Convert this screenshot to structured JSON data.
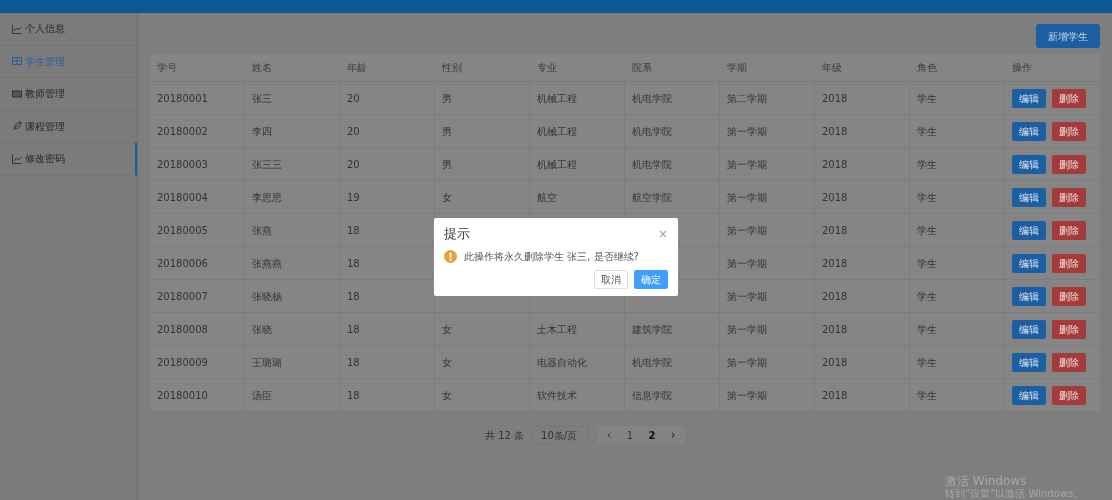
{
  "sidebar": {
    "items": [
      {
        "label": "个人信息",
        "selected": false,
        "active_bar": false
      },
      {
        "label": "学生管理",
        "selected": true,
        "active_bar": false
      },
      {
        "label": "教师管理",
        "selected": false,
        "active_bar": false
      },
      {
        "label": "课程管理",
        "selected": false,
        "active_bar": false
      },
      {
        "label": "修改密码",
        "selected": false,
        "active_bar": true
      }
    ]
  },
  "toolbar": {
    "add_button": "新增学生"
  },
  "table": {
    "columns": [
      "学号",
      "姓名",
      "年龄",
      "性别",
      "专业",
      "院系",
      "学期",
      "年级",
      "角色",
      "操作"
    ],
    "rows": [
      {
        "cells": [
          "20180001",
          "张三",
          "20",
          "男",
          "机械工程",
          "机电学院",
          "第二学期",
          "2018",
          "学生"
        ],
        "edit": "编辑",
        "delete": "删除"
      },
      {
        "cells": [
          "20180002",
          "李四",
          "20",
          "男",
          "机械工程",
          "机电学院",
          "第一学期",
          "2018",
          "学生"
        ],
        "edit": "编辑",
        "delete": "删除"
      },
      {
        "cells": [
          "20180003",
          "张三三",
          "20",
          "男",
          "机械工程",
          "机电学院",
          "第一学期",
          "2018",
          "学生"
        ],
        "edit": "编辑",
        "delete": "删除"
      },
      {
        "cells": [
          "20180004",
          "李思思",
          "19",
          "女",
          "航空",
          "航空学院",
          "第一学期",
          "2018",
          "学生"
        ],
        "edit": "编辑",
        "delete": "删除"
      },
      {
        "cells": [
          "20180005",
          "张燕",
          "18",
          null,
          null,
          null,
          "第一学期",
          "2018",
          "学生"
        ],
        "edit": "编辑",
        "delete": "删除"
      },
      {
        "cells": [
          "20180006",
          "张燕燕",
          "18",
          null,
          null,
          null,
          "第一学期",
          "2018",
          "学生"
        ],
        "edit": "编辑",
        "delete": "删除"
      },
      {
        "cells": [
          "20180007",
          "张晓杨",
          "18",
          null,
          null,
          null,
          "第一学期",
          "2018",
          "学生"
        ],
        "edit": "编辑",
        "delete": "删除"
      },
      {
        "cells": [
          "20180008",
          "张晓",
          "18",
          "女",
          "土木工程",
          "建筑学院",
          "第一学期",
          "2018",
          "学生"
        ],
        "edit": "编辑",
        "delete": "删除"
      },
      {
        "cells": [
          "20180009",
          "王璐璐",
          "18",
          "女",
          "电器自动化",
          "机电学院",
          "第一学期",
          "2018",
          "学生"
        ],
        "edit": "编辑",
        "delete": "删除"
      },
      {
        "cells": [
          "20180010",
          "汤臣",
          "18",
          "女",
          "软件技术",
          "信息学院",
          "第一学期",
          "2018",
          "学生"
        ],
        "edit": "编辑",
        "delete": "删除"
      }
    ]
  },
  "pagination": {
    "total": "共 12 条",
    "page_size": "10条/页",
    "prev": "‹",
    "next": "›",
    "pages": [
      {
        "label": "1",
        "selected": false
      },
      {
        "label": "2",
        "selected": true
      }
    ]
  },
  "dialog": {
    "title": "提示",
    "close": "×",
    "message": "此操作将永久删除学生 张三, 是否继续?",
    "cancel": "取消",
    "confirm": "确定"
  },
  "os_notice": {
    "title": "激活 Windows",
    "subtitle": "转到“设置”以激活 Windows。"
  }
}
